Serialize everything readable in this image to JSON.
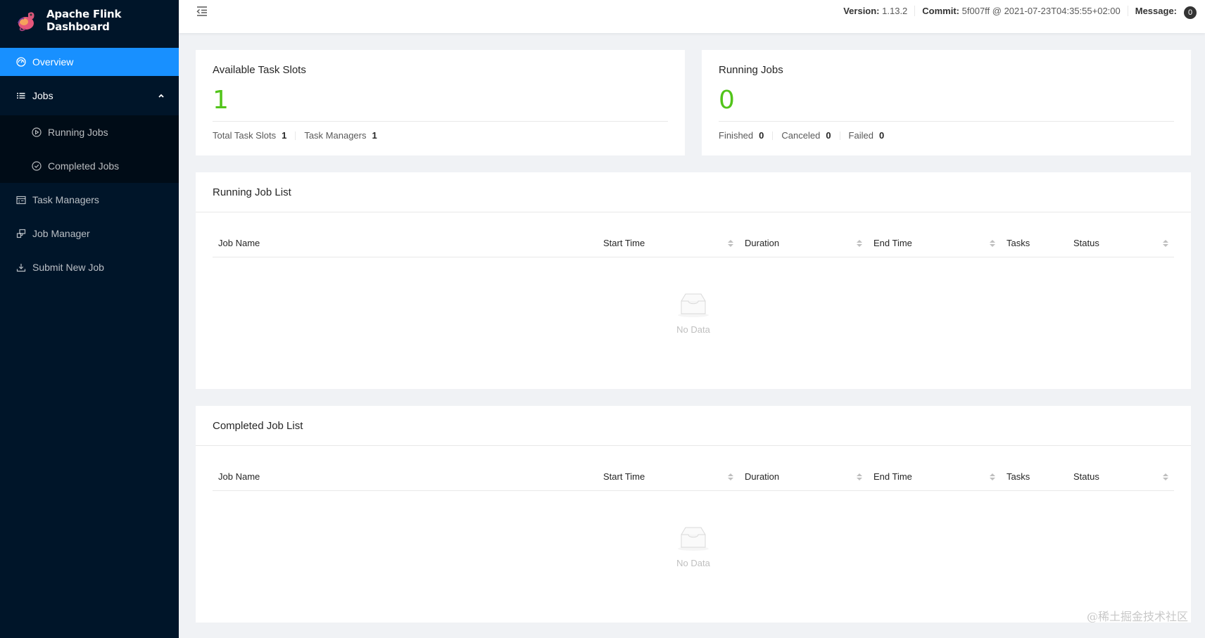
{
  "app": {
    "title": "Apache Flink Dashboard"
  },
  "sidebar": {
    "items": [
      {
        "label": "Overview",
        "icon": "dashboard-icon"
      },
      {
        "label": "Jobs",
        "icon": "list-icon"
      },
      {
        "label": "Running Jobs",
        "icon": "play-circle-icon"
      },
      {
        "label": "Completed Jobs",
        "icon": "check-circle-icon"
      },
      {
        "label": "Task Managers",
        "icon": "schedule-icon"
      },
      {
        "label": "Job Manager",
        "icon": "cluster-icon"
      },
      {
        "label": "Submit New Job",
        "icon": "upload-icon"
      }
    ]
  },
  "header": {
    "version_label": "Version:",
    "version_value": "1.13.2",
    "commit_label": "Commit:",
    "commit_value": "5f007ff @ 2021-07-23T04:35:55+02:00",
    "message_label": "Message:",
    "message_count": "0"
  },
  "task_slots": {
    "title": "Available Task Slots",
    "value": "1",
    "total_label": "Total Task Slots",
    "total_value": "1",
    "tm_label": "Task Managers",
    "tm_value": "1"
  },
  "running_jobs": {
    "title": "Running Jobs",
    "value": "0",
    "finished_label": "Finished",
    "finished_value": "0",
    "canceled_label": "Canceled",
    "canceled_value": "0",
    "failed_label": "Failed",
    "failed_value": "0"
  },
  "running_list": {
    "title": "Running Job List",
    "columns": [
      "Job Name",
      "Start Time",
      "Duration",
      "End Time",
      "Tasks",
      "Status"
    ],
    "empty_text": "No Data"
  },
  "completed_list": {
    "title": "Completed Job List",
    "columns": [
      "Job Name",
      "Start Time",
      "Duration",
      "End Time",
      "Tasks",
      "Status"
    ],
    "empty_text": "No Data"
  },
  "colors": {
    "sidebar_bg": "#001529",
    "active": "#1890ff",
    "stat_value": "#52c41a"
  },
  "watermark": "@稀土掘金技术社区"
}
